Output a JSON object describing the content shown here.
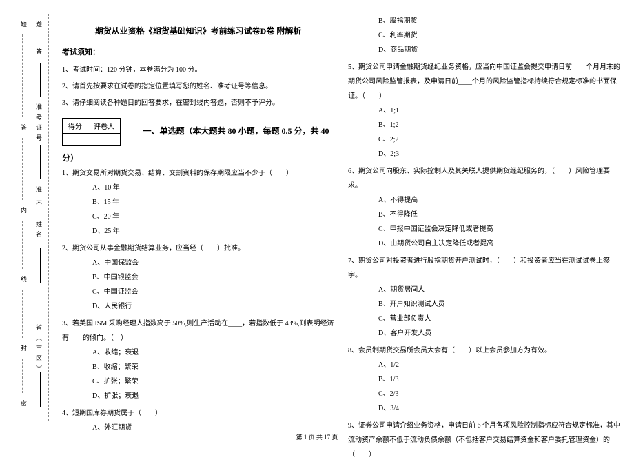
{
  "sidebar": {
    "seal_chars": [
      "题",
      "答",
      "准",
      "不",
      "内",
      "线",
      "封",
      "密"
    ],
    "labels": {
      "exam_id": "准考证号",
      "name": "姓名",
      "province": "省（市区）"
    }
  },
  "header": {
    "title": "期货从业资格《期货基础知识》考前练习试卷D卷 附解析"
  },
  "notice": {
    "heading": "考试须知：",
    "items": [
      "1、考试时间：120 分钟，本卷满分为 100 分。",
      "2、请首先按要求在试卷的指定位置填写您的姓名、准考证号等信息。",
      "3、请仔细阅读各种题目的回答要求，在密封线内答题，否则不予评分。"
    ]
  },
  "score_box": {
    "score": "得分",
    "grader": "评卷人"
  },
  "section1": {
    "title": "一、单选题（本大题共 80 小题，每题 0.5 分，共 40 分）"
  },
  "questions": [
    {
      "num": "1",
      "text": "、期货交易所对期货交易、结算、交割资料的保存期限应当不少于（　　）",
      "opts": [
        "A、10 年",
        "B、15 年",
        "C、20 年",
        "D、25 年"
      ]
    },
    {
      "num": "2",
      "text": "、期货公司从事金融期货结算业务，应当经（　　）批准。",
      "opts": [
        "A、中国保监会",
        "B、中国银监会",
        "C、中国证监会",
        "D、人民银行"
      ]
    },
    {
      "num": "3",
      "text": "、若美国 ISM 采购经理人指数高于 50%,则生产活动在____，若指数低于 43%,则表明经济有____的倾向。（　）",
      "opts": [
        "A、收缩；衰退",
        "B、收缩；繁荣",
        "C、扩张；繁荣",
        "D、扩张；衰退"
      ]
    },
    {
      "num": "4",
      "text": "、短期国库券期货属于（　　）",
      "opts": [
        "A、外汇期货"
      ]
    }
  ],
  "questions_right_pre": {
    "opts": [
      "B、股指期货",
      "C、利率期货",
      "D、商品期货"
    ]
  },
  "questions_right": [
    {
      "num": "5",
      "text": "、期货公司申请金融期货经纪业务资格，应当向中国证监会提交申请日前____个月月末的期货公司风险监管报表，及申请日前____个月的风险监管指标持续符合规定标准的书面保证。（　　）",
      "opts": [
        "A、1;1",
        "B、1;2",
        "C、2;2",
        "D、2;3"
      ]
    },
    {
      "num": "6",
      "text": "、期货公司向股东、实际控制人及其关联人提供期货经纪服务的，（　　）风险管理要求。",
      "opts": [
        "A、不得提高",
        "B、不得降低",
        "C、申报中国证监会决定降低或者提高",
        "D、由期货公司自主决定降低或者提高"
      ]
    },
    {
      "num": "7",
      "text": "、期货公司对投资者进行股指期货开户测试时，（　　）和投资者应当在测试试卷上签字。",
      "opts": [
        "A、期货居间人",
        "B、开户知识测试人员",
        "C、营业部负责人",
        "D、客户开发人员"
      ]
    },
    {
      "num": "8",
      "text": "、会员制期货交易所会员大会有（　　）以上会员参加方为有效。",
      "opts": [
        "A、1/2",
        "B、1/3",
        "C、2/3",
        "D、3/4"
      ]
    },
    {
      "num": "9",
      "text": "、证券公司申请介绍业务资格，申请日前 6 个月各项风险控制指标应符合规定标准，其中流动资产余额不低于流动负债余额（不包括客户交易结算资金和客户委托管理资金）的（　　）",
      "opts": []
    }
  ],
  "footer": "第 1 页 共 17 页"
}
